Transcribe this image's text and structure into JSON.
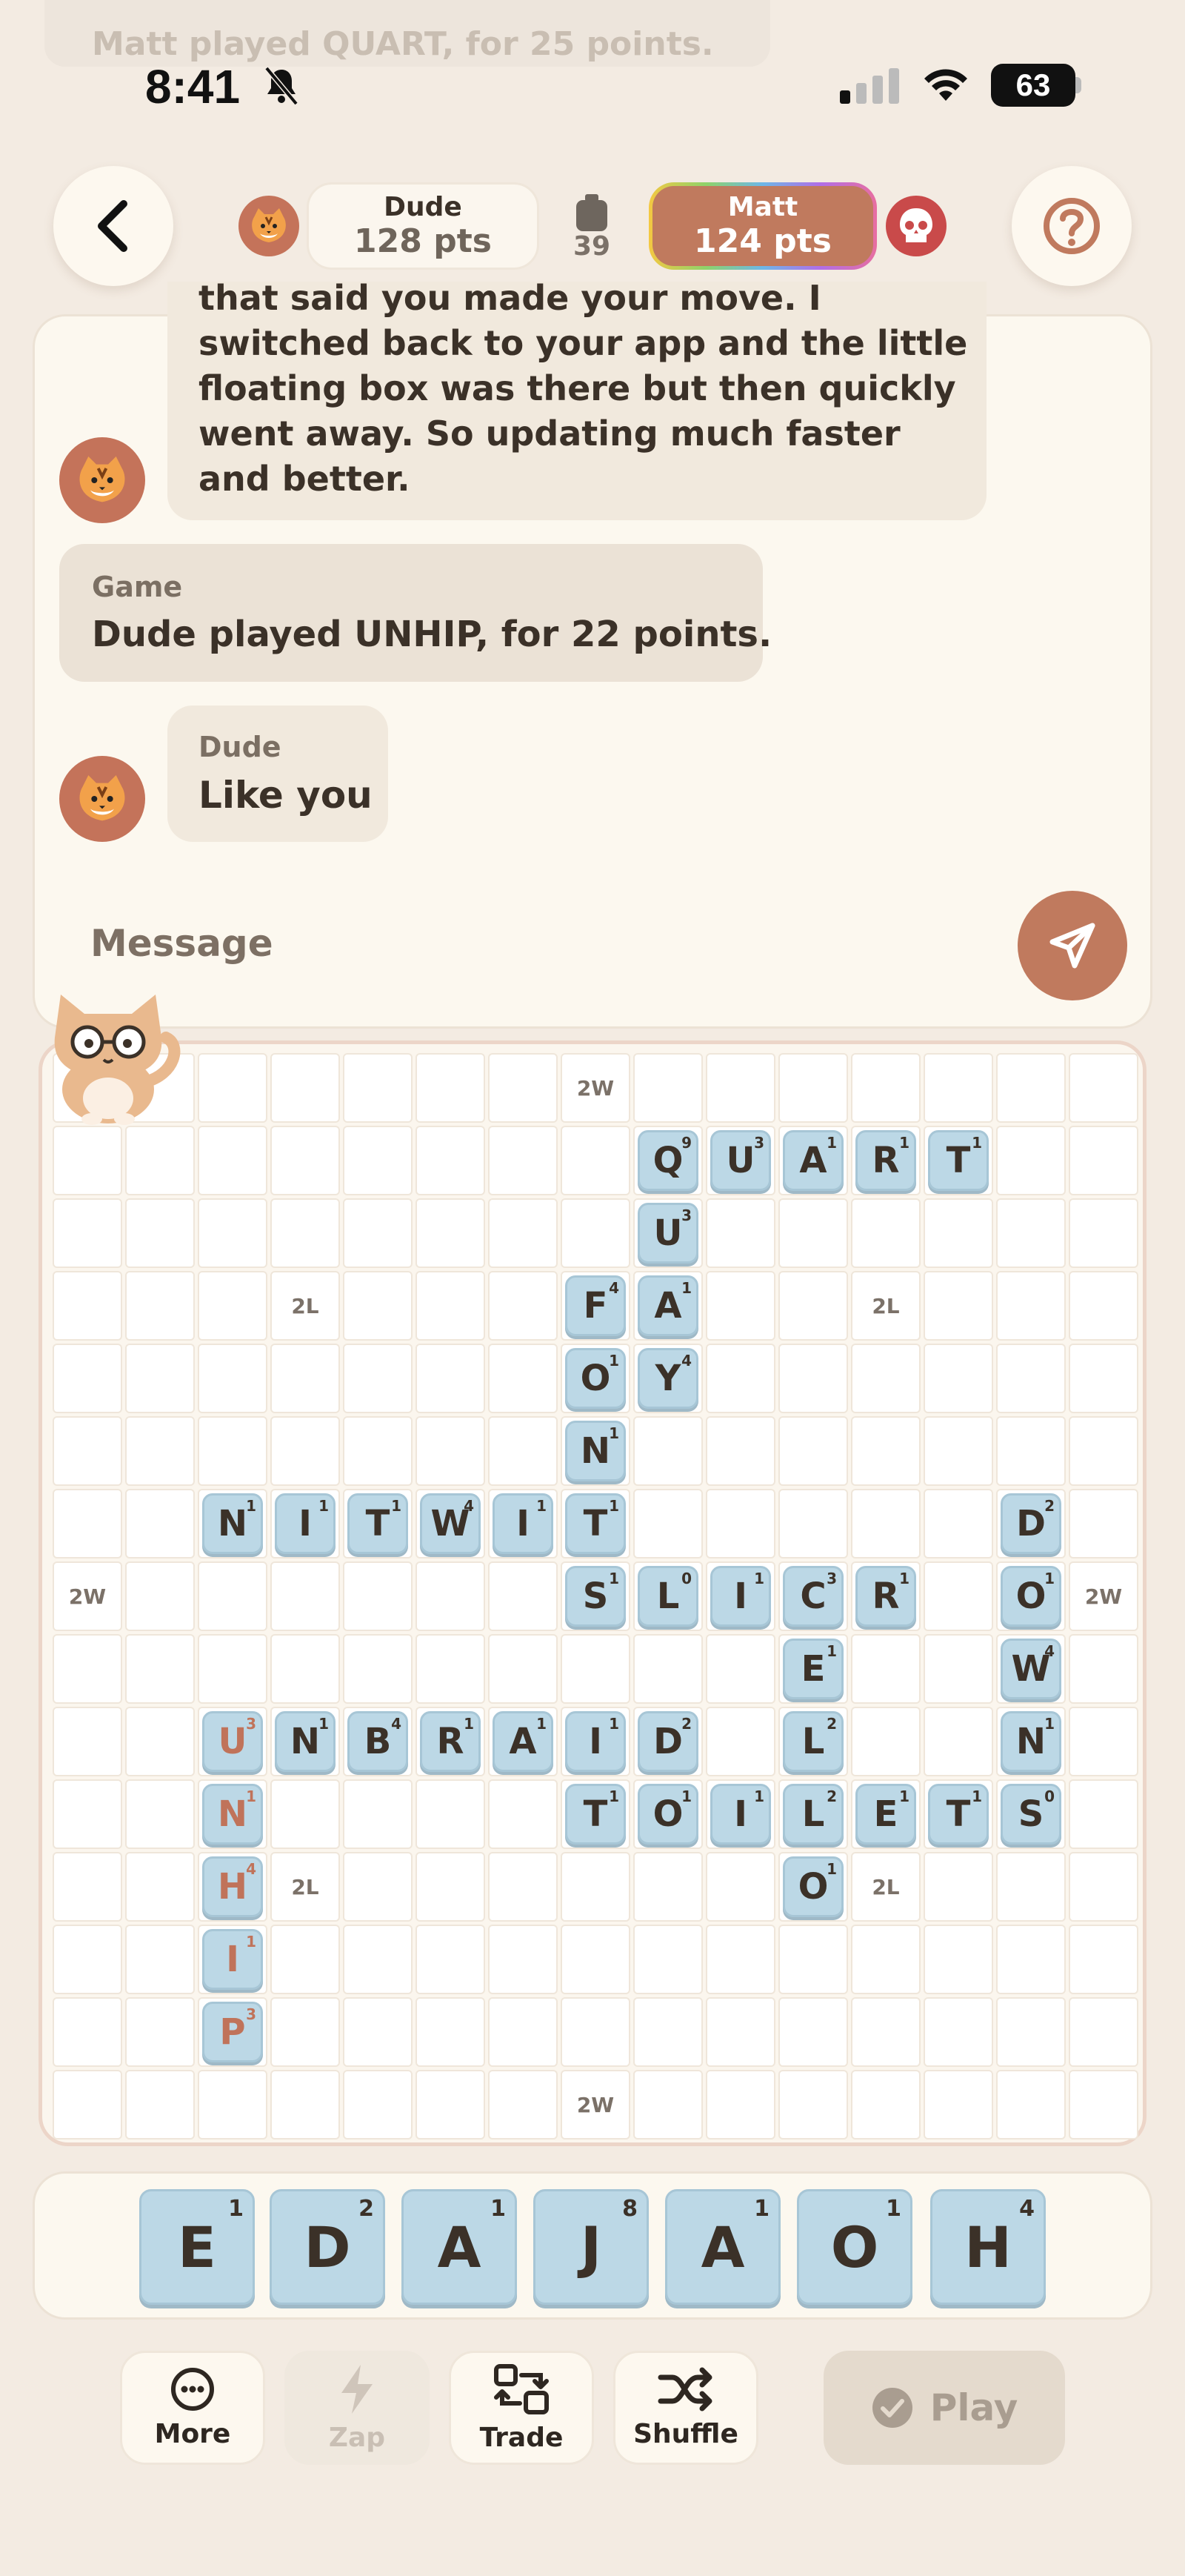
{
  "status_bar": {
    "time": "8:41",
    "battery": "63"
  },
  "ghost": {
    "text": "Matt played QUART, for 25 points."
  },
  "header": {
    "player1": {
      "name": "Dude",
      "points": "128 pts"
    },
    "bag_count": "39",
    "player2": {
      "name": "Matt",
      "points": "124 pts"
    }
  },
  "chat": {
    "message1_text": "Dude\nDude ... another ... a notification that said you made your move. I switched back to your app and the little floating box was there but then quickly went away. So updating much faster and better.",
    "message1_visible": "that said you made your move. I switched back to your app and the little floating box was there but then quickly went away. So updating much faster and better.",
    "game_title": "Game",
    "game_text": "Dude played UNHIP, for 22 points.",
    "dude_name": "Dude",
    "dude_text": "Like you",
    "input_placeholder": "Message"
  },
  "board": {
    "premiums": [
      {
        "r": 0,
        "c": 7,
        "label": "2W"
      },
      {
        "r": 3,
        "c": 3,
        "label": "2L"
      },
      {
        "r": 3,
        "c": 11,
        "label": "2L"
      },
      {
        "r": 7,
        "c": 0,
        "label": "2W"
      },
      {
        "r": 7,
        "c": 14,
        "label": "2W"
      },
      {
        "r": 11,
        "c": 3,
        "label": "2L"
      },
      {
        "r": 11,
        "c": 11,
        "label": "2L"
      },
      {
        "r": 14,
        "c": 7,
        "label": "2W"
      }
    ],
    "tiles": [
      {
        "r": 1,
        "c": 8,
        "l": "Q",
        "s": "9"
      },
      {
        "r": 1,
        "c": 9,
        "l": "U",
        "s": "3"
      },
      {
        "r": 1,
        "c": 10,
        "l": "A",
        "s": "1"
      },
      {
        "r": 1,
        "c": 11,
        "l": "R",
        "s": "1"
      },
      {
        "r": 1,
        "c": 12,
        "l": "T",
        "s": "1"
      },
      {
        "r": 2,
        "c": 8,
        "l": "U",
        "s": "3"
      },
      {
        "r": 3,
        "c": 7,
        "l": "F",
        "s": "4"
      },
      {
        "r": 3,
        "c": 8,
        "l": "A",
        "s": "1"
      },
      {
        "r": 4,
        "c": 7,
        "l": "O",
        "s": "1"
      },
      {
        "r": 4,
        "c": 8,
        "l": "Y",
        "s": "4"
      },
      {
        "r": 5,
        "c": 7,
        "l": "N",
        "s": "1"
      },
      {
        "r": 6,
        "c": 2,
        "l": "N",
        "s": "1"
      },
      {
        "r": 6,
        "c": 3,
        "l": "I",
        "s": "1"
      },
      {
        "r": 6,
        "c": 4,
        "l": "T",
        "s": "1"
      },
      {
        "r": 6,
        "c": 5,
        "l": "W",
        "s": "4"
      },
      {
        "r": 6,
        "c": 6,
        "l": "I",
        "s": "1"
      },
      {
        "r": 6,
        "c": 7,
        "l": "T",
        "s": "1"
      },
      {
        "r": 6,
        "c": 13,
        "l": "D",
        "s": "2"
      },
      {
        "r": 7,
        "c": 7,
        "l": "S",
        "s": "1"
      },
      {
        "r": 7,
        "c": 8,
        "l": "L",
        "s": "0"
      },
      {
        "r": 7,
        "c": 9,
        "l": "I",
        "s": "1"
      },
      {
        "r": 7,
        "c": 10,
        "l": "C",
        "s": "3"
      },
      {
        "r": 7,
        "c": 11,
        "l": "R",
        "s": "1"
      },
      {
        "r": 7,
        "c": 13,
        "l": "O",
        "s": "1"
      },
      {
        "r": 8,
        "c": 10,
        "l": "E",
        "s": "1"
      },
      {
        "r": 8,
        "c": 13,
        "l": "W",
        "s": "4"
      },
      {
        "r": 9,
        "c": 2,
        "l": "U",
        "s": "3",
        "last": true
      },
      {
        "r": 9,
        "c": 3,
        "l": "N",
        "s": "1"
      },
      {
        "r": 9,
        "c": 4,
        "l": "B",
        "s": "4"
      },
      {
        "r": 9,
        "c": 5,
        "l": "R",
        "s": "1"
      },
      {
        "r": 9,
        "c": 6,
        "l": "A",
        "s": "1"
      },
      {
        "r": 9,
        "c": 7,
        "l": "I",
        "s": "1"
      },
      {
        "r": 9,
        "c": 8,
        "l": "D",
        "s": "2"
      },
      {
        "r": 9,
        "c": 10,
        "l": "L",
        "s": "2"
      },
      {
        "r": 9,
        "c": 13,
        "l": "N",
        "s": "1"
      },
      {
        "r": 10,
        "c": 2,
        "l": "N",
        "s": "1",
        "last": true
      },
      {
        "r": 10,
        "c": 7,
        "l": "T",
        "s": "1"
      },
      {
        "r": 10,
        "c": 8,
        "l": "O",
        "s": "1"
      },
      {
        "r": 10,
        "c": 9,
        "l": "I",
        "s": "1"
      },
      {
        "r": 10,
        "c": 10,
        "l": "L",
        "s": "2"
      },
      {
        "r": 10,
        "c": 11,
        "l": "E",
        "s": "1"
      },
      {
        "r": 10,
        "c": 12,
        "l": "T",
        "s": "1"
      },
      {
        "r": 10,
        "c": 13,
        "l": "S",
        "s": "0"
      },
      {
        "r": 11,
        "c": 2,
        "l": "H",
        "s": "4",
        "last": true
      },
      {
        "r": 11,
        "c": 10,
        "l": "O",
        "s": "1"
      },
      {
        "r": 12,
        "c": 2,
        "l": "I",
        "s": "1",
        "last": true
      },
      {
        "r": 13,
        "c": 2,
        "l": "P",
        "s": "3",
        "last": true
      }
    ]
  },
  "rack": [
    {
      "l": "E",
      "s": "1"
    },
    {
      "l": "D",
      "s": "2"
    },
    {
      "l": "A",
      "s": "1"
    },
    {
      "l": "J",
      "s": "8"
    },
    {
      "l": "A",
      "s": "1"
    },
    {
      "l": "O",
      "s": "1"
    },
    {
      "l": "H",
      "s": "4"
    }
  ],
  "actions": {
    "more": "More",
    "zap": "Zap",
    "trade": "Trade",
    "shuffle": "Shuffle",
    "play": "Play"
  },
  "colors": {
    "accent": "#c07a5e",
    "tile": "#bcd8e6",
    "background": "#f3ebe2"
  }
}
